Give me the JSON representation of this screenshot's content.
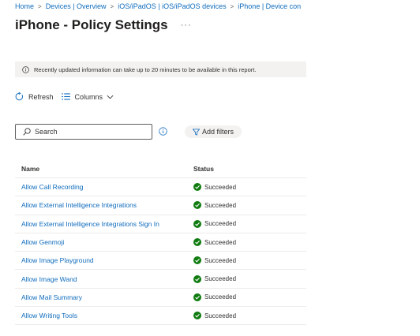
{
  "breadcrumb": [
    "Home",
    "Devices | Overview",
    "iOS/iPadOS | iOS/iPadOS devices",
    "iPhone | Device con"
  ],
  "breadcrumb_sep": ">",
  "page_title": "iPhone - Policy Settings",
  "more_label": "···",
  "info_message": "Recently updated information can take up to 20 minutes to be available in this report.",
  "toolbar": {
    "refresh_label": "Refresh",
    "columns_label": "Columns"
  },
  "search": {
    "placeholder": "Search"
  },
  "filter_label": "Add filters",
  "table": {
    "columns": [
      "Name",
      "Status"
    ],
    "rows": [
      {
        "name": "Allow Call Recording",
        "status": "Succeeded"
      },
      {
        "name": "Allow External Intelligence Integrations",
        "status": "Succeeded"
      },
      {
        "name": "Allow External Intelligence Integrations Sign In",
        "status": "Succeeded"
      },
      {
        "name": "Allow Genmoji",
        "status": "Succeeded"
      },
      {
        "name": "Allow Image Playground",
        "status": "Succeeded"
      },
      {
        "name": "Allow Image Wand",
        "status": "Succeeded"
      },
      {
        "name": "Allow Mail Summary",
        "status": "Succeeded"
      },
      {
        "name": "Allow Writing Tools",
        "status": "Succeeded"
      }
    ]
  },
  "colors": {
    "link": "#0f6cbd",
    "success": "#107c10",
    "info_bg": "#f3f2f1"
  },
  "icons": {
    "info": "info-icon",
    "refresh": "refresh-icon",
    "columns": "columns-icon",
    "chevron": "chevron-down-icon",
    "search": "search-icon",
    "filter": "filter-icon",
    "status": "checkmark-circle-icon"
  }
}
